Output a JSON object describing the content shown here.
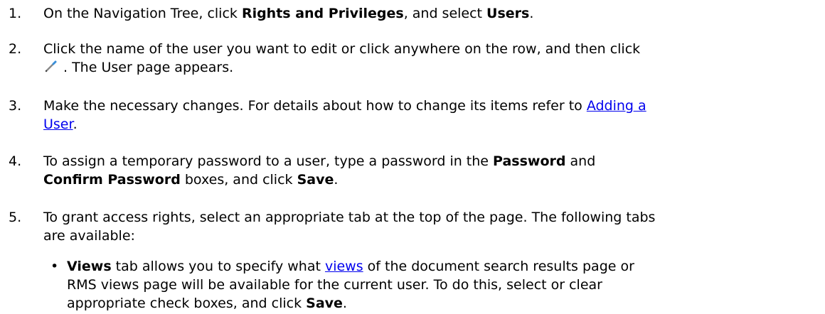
{
  "steps": [
    {
      "num": "1.",
      "t1": "On the Navigation Tree, click ",
      "b1": "Rights and Privileges",
      "t2": ", and select ",
      "b2": "Users",
      "t3": "."
    },
    {
      "num": "2.",
      "line1": "Click the name of the user you want to edit or click anywhere on the row, and then click",
      "icon": "pencil-edit-icon",
      "line2": ". The User page appears."
    },
    {
      "num": "3.",
      "t1": "Make the necessary changes. For details about how to change its items refer to ",
      "link_a": "Adding a",
      "link_b": "User",
      "t2": "."
    },
    {
      "num": "4.",
      "t1": "To assign a temporary password to a user, type a password in the ",
      "b1": "Password",
      "t2": " and",
      "b2": "Confirm Password",
      "t3": " boxes, and click ",
      "b3": "Save",
      "t4": "."
    },
    {
      "num": "5.",
      "line1": "To grant access rights, select an appropriate tab at the top of the page. The following tabs",
      "line2": "are available:"
    }
  ],
  "bullets": [
    {
      "bullet": "•",
      "b1": "Views",
      "t1": " tab allows you to specify what ",
      "link": "views",
      "t2": " of the document search results page or",
      "line2": "RMS views page will be available for the current user. To do this, select or clear",
      "t3": "appropriate check boxes, and click ",
      "b2": "Save",
      "t4": "."
    }
  ],
  "colors": {
    "link": "#0000ee",
    "text": "#000000",
    "pencil_tip": "#3a8fd9"
  }
}
